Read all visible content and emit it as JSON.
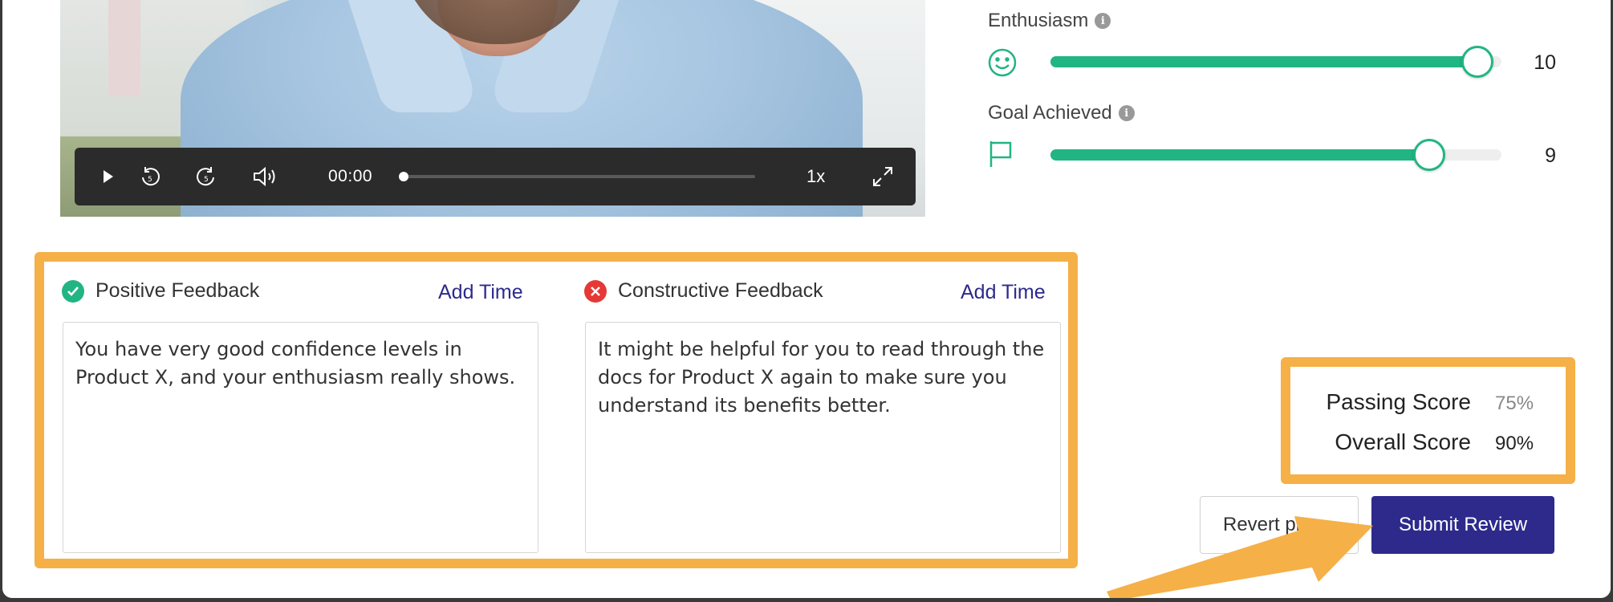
{
  "video": {
    "time": "00:00",
    "speed": "1x",
    "progress": 0.0
  },
  "metrics": [
    {
      "label": "Enthusiasm",
      "value": "10",
      "level": 1.0,
      "icon": "smiley-icon"
    },
    {
      "label": "Goal Achieved",
      "value": "9",
      "level": 0.9,
      "icon": "flag-icon"
    }
  ],
  "feedback": {
    "positive": {
      "title": "Positive Feedback",
      "add_time": "Add Time",
      "text": "You have very good confidence levels in Product X, and your enthusiasm really shows."
    },
    "constructive": {
      "title": "Constructive Feedback",
      "add_time": "Add Time",
      "text": "It might be helpful for you to read through the docs for Product X again to make sure you understand its benefits better."
    }
  },
  "scores": {
    "passing_label": "Passing Score",
    "passing_value": "75%",
    "overall_label": "Overall Score",
    "overall_value": "90%"
  },
  "buttons": {
    "revert": "Revert pi",
    "submit": "Submit Review"
  },
  "colors": {
    "accent_green": "#21b584",
    "primary_navy": "#2d2a8c",
    "highlight_orange": "#f5b048",
    "error_red": "#e53935"
  }
}
